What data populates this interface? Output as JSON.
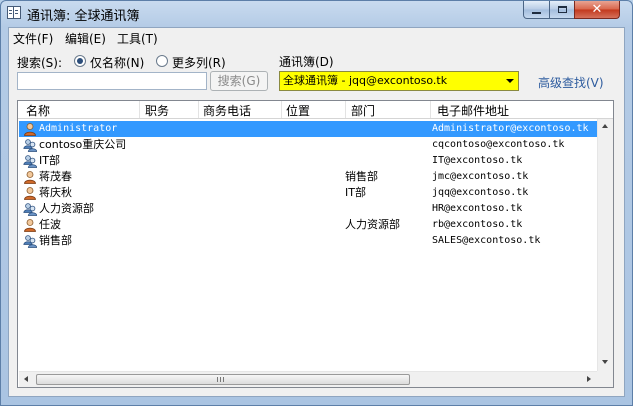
{
  "window": {
    "title": "通讯簿: 全球通讯簿"
  },
  "menu": [
    "文件(F)",
    "编辑(E)",
    "工具(T)"
  ],
  "search": {
    "label": "搜索(S):",
    "option_name_only": "仅名称(N)",
    "option_more_columns": "更多列(R)",
    "selected_option": "仅名称(N)",
    "input_value": "",
    "button_label": "搜索(G)"
  },
  "address_book": {
    "label": "通讯簿(D)",
    "selected": "全球通讯簿 - jqq@excontoso.tk",
    "advanced_link": "高级查找(V)",
    "highlight_color": "#ffff00"
  },
  "list": {
    "columns": [
      "名称",
      "职务",
      "商务电话",
      "位置",
      "部门",
      "电子邮件地址"
    ],
    "selected_color": "#3399ff",
    "rows": [
      {
        "icon": "user-icon",
        "name": "Administrator",
        "department": "",
        "email": "Administrator@excontoso.tk",
        "selected": true
      },
      {
        "icon": "group-icon",
        "name": "contoso重庆公司",
        "department": "",
        "email": "cqcontoso@excontoso.tk",
        "selected": false
      },
      {
        "icon": "group-icon",
        "name": "IT部",
        "department": "",
        "email": "IT@excontoso.tk",
        "selected": false
      },
      {
        "icon": "user-icon",
        "name": "蒋茂春",
        "department": "销售部",
        "email": "jmc@excontoso.tk",
        "selected": false
      },
      {
        "icon": "user-icon",
        "name": "蒋庆秋",
        "department": "IT部",
        "email": "jqq@excontoso.tk",
        "selected": false
      },
      {
        "icon": "group-icon",
        "name": "人力资源部",
        "department": "",
        "email": "HR@excontoso.tk",
        "selected": false
      },
      {
        "icon": "user-icon",
        "name": "任波",
        "department": "人力资源部",
        "email": "rb@excontoso.tk",
        "selected": false
      },
      {
        "icon": "group-icon",
        "name": "销售部",
        "department": "",
        "email": "SALES@excontoso.tk",
        "selected": false
      }
    ]
  }
}
